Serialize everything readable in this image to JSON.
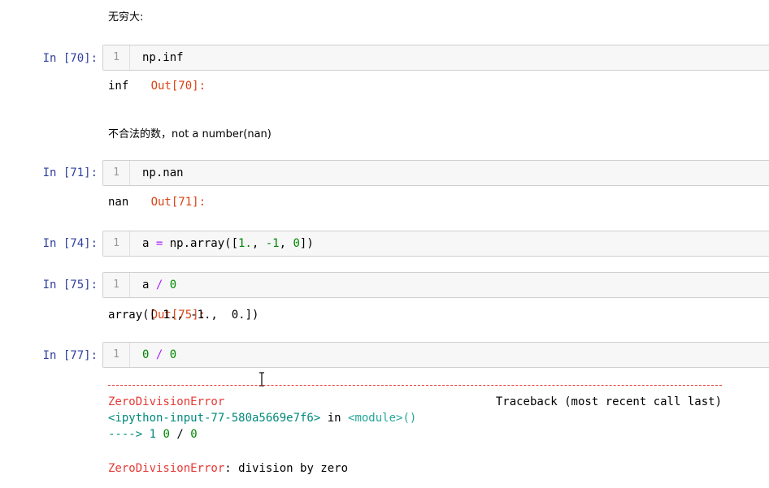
{
  "cells": [
    {
      "type": "markdown",
      "text": "无穷大:"
    },
    {
      "type": "code",
      "prompt": "In [70]:",
      "line": "1",
      "code": [
        "np.inf"
      ],
      "out_prompt": "Out[70]:",
      "output": "inf"
    },
    {
      "type": "markdown",
      "text": "不合法的数，not a number(nan)"
    },
    {
      "type": "code",
      "prompt": "In [71]:",
      "line": "1",
      "code": [
        "np.nan"
      ],
      "out_prompt": "Out[71]:",
      "output": "nan"
    },
    {
      "type": "code",
      "prompt": "In [74]:",
      "line": "1",
      "code": [
        "a ",
        "=",
        " np.array([",
        "1.",
        ", ",
        "-1",
        ", ",
        "0",
        "])"
      ]
    },
    {
      "type": "code",
      "prompt": "In [75]:",
      "line": "1",
      "code": [
        "a ",
        "/",
        " ",
        "0"
      ],
      "out_prompt": "Out[75]:",
      "output": "array([ 1., -1.,  0.])"
    },
    {
      "type": "code",
      "prompt": "In [77]:",
      "line": "1",
      "code": [
        "0",
        " ",
        "/",
        " ",
        "0"
      ]
    }
  ],
  "traceback": {
    "error_name": "ZeroDivisionError",
    "header_right": "Traceback (most recent call last)",
    "input_ref": "<ipython-input-77-580a5669e7f6>",
    "in_word": " in ",
    "module_ref": "<module>()",
    "arrow": "---->",
    "arrow_line": " 1 ",
    "arrow_code": [
      "0",
      " / ",
      "0"
    ],
    "final_error": "ZeroDivisionError",
    "final_message": ": division by zero"
  },
  "colors": {
    "in_prompt": "#303f9f",
    "out_prompt": "#d84315",
    "error_red": "#e53935",
    "link_green": "#00897b",
    "number_green": "#008800",
    "operator_purple": "#aa22ff"
  }
}
